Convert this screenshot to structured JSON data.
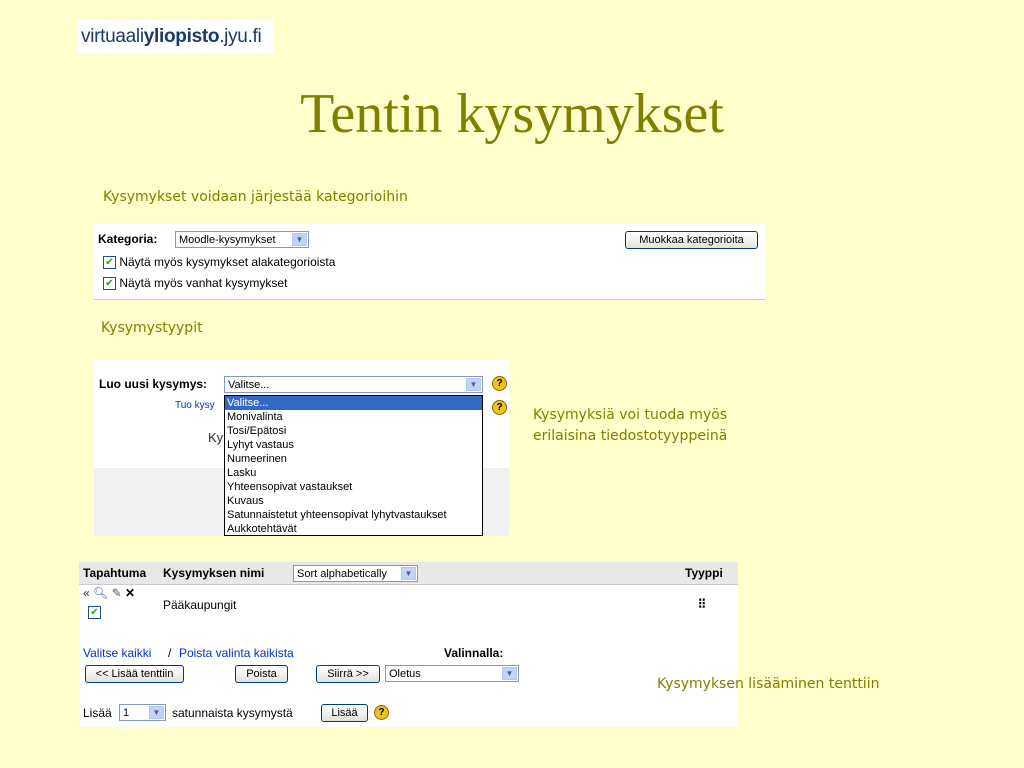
{
  "logo": {
    "prefix": "virtuaali",
    "bold": "yliopisto",
    "suffix": ".jyu.fi"
  },
  "title": "Tentin kysymykset",
  "captions": {
    "categories": "Kysymykset voidaan järjestää kategorioihin",
    "types": "Kysymystyypit",
    "import_line1": "Kysymyksiä voi tuoda myös",
    "import_line2": "erilaisina tiedostotyyppeinä",
    "add": "Kysymyksen lisääminen tenttiin"
  },
  "category_panel": {
    "label": "Kategoria:",
    "select_value": "Moodle-kysymykset",
    "edit_button": "Muokkaa kategorioita",
    "check1": "Näytä myös kysymykset alakategorioista",
    "check2": "Näytä myös vanhat kysymykset"
  },
  "create_panel": {
    "label": "Luo uusi kysymys:",
    "select_value": "Valitse...",
    "import_link_partial": "Tuo kysy",
    "hidden_text_partial": "Ky",
    "options": [
      "Valitse...",
      "Monivalinta",
      "Tosi/Epätosi",
      "Lyhyt vastaus",
      "Numeerinen",
      "Lasku",
      "Yhteensopivat vastaukset",
      "Kuvaus",
      "Satunnaistetut yhteensopivat lyhytvastaukset",
      "Aukkotehtävät"
    ]
  },
  "question_panel": {
    "col_action": "Tapahtuma",
    "col_name": "Kysymyksen nimi",
    "sort_value": "Sort alphabetically",
    "col_type": "Tyyppi",
    "row_name": "Pääkaupungit",
    "select_all": "Valitse kaikki",
    "separator": "/",
    "deselect_all": "Poista valinta kaikista",
    "optional_label": "Valinnalla:",
    "add_to_quiz": "<< Lisää tenttiin",
    "delete": "Poista",
    "move": "Siirrä >>",
    "target_select": "Oletus",
    "add_prefix": "Lisää",
    "count_value": "1",
    "add_suffix": "satunnaista kysymystä",
    "add_button": "Lisää"
  }
}
